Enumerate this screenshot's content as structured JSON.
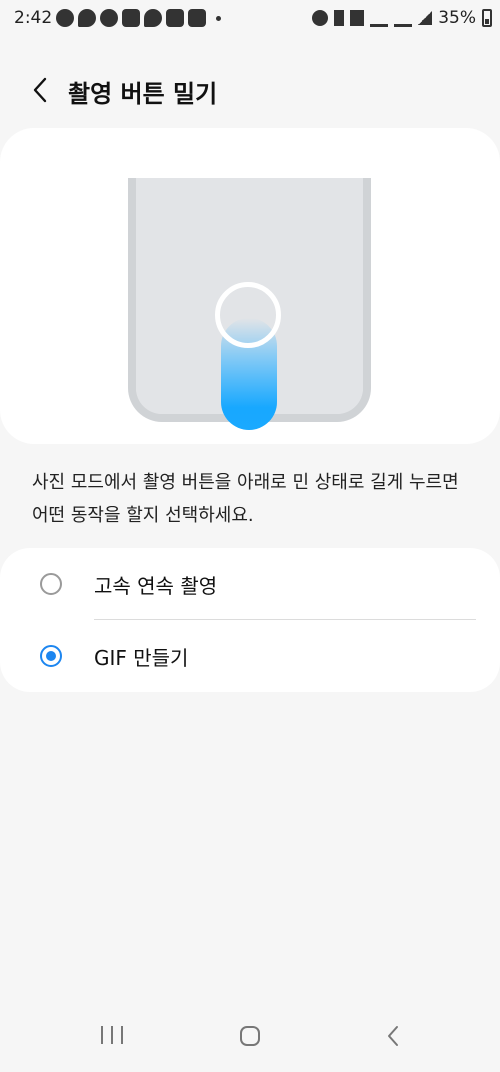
{
  "status_bar": {
    "time": "2:42",
    "battery": "35%",
    "left_icons": [
      "telegram-icon",
      "talk-icon",
      "pill-icon",
      "grid-icon",
      "chat-icon",
      "app-icon",
      "grid-icon",
      "dot-icon"
    ],
    "right_icons": [
      "alarm-icon",
      "bluetooth-icon",
      "mute-icon",
      "hd-voice-icon",
      "lte-icon",
      "signal-icon",
      "battery-icon"
    ]
  },
  "header": {
    "back_icon": "chevron-left-icon",
    "title": "촬영 버튼 밀기"
  },
  "illustration": {
    "accent_color": "#18a8ff",
    "phone_color": "#e2e4e7"
  },
  "description": "사진 모드에서 촬영 버튼을 아래로 민 상태로 길게 누르면 어떤 동작을 할지 선택하세요.",
  "options": [
    {
      "label": "고속 연속 촬영",
      "selected": false
    },
    {
      "label": "GIF 만들기",
      "selected": true
    }
  ],
  "colors": {
    "radio_selected": "#1d86f0",
    "background": "#f6f6f6"
  },
  "nav_bar": {
    "recents_icon": "recents-icon",
    "home_icon": "home-icon",
    "back_icon": "back-icon"
  }
}
